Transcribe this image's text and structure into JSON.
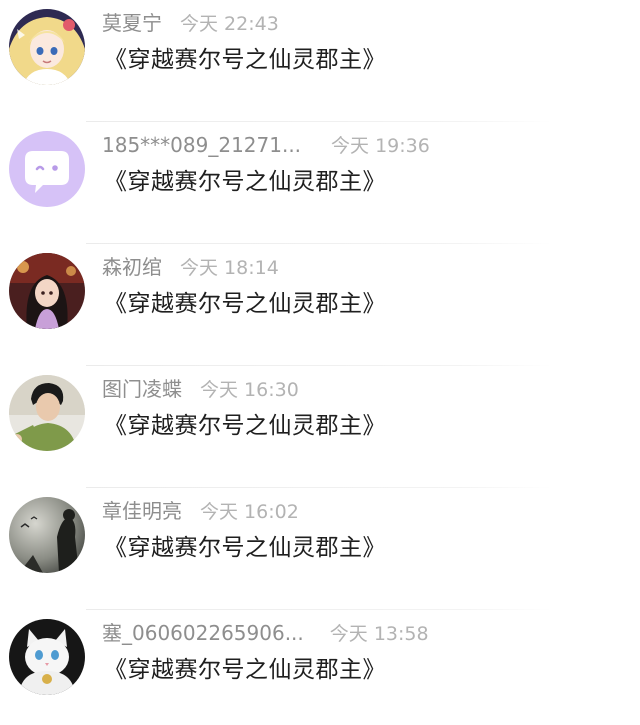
{
  "messages": [
    {
      "name": "莫夏宁",
      "time": "今天 22:43",
      "text": "《穿越赛尔号之仙灵郡主》",
      "avatar": "anime-girl-blonde-avatar"
    },
    {
      "name": "185***089_21271...",
      "time": "今天 19:36",
      "text": "《穿越赛尔号之仙灵郡主》",
      "avatar": "default-chat-bubble-avatar"
    },
    {
      "name": "森初绾",
      "time": "今天 18:14",
      "text": "《穿越赛尔号之仙灵郡主》",
      "avatar": "illustrated-girl-avatar"
    },
    {
      "name": "图门凌蝶",
      "time": "今天 16:30",
      "text": "《穿越赛尔号之仙灵郡主》",
      "avatar": "young-man-photo-avatar"
    },
    {
      "name": "章佳明亮",
      "time": "今天 16:02",
      "text": "《穿越赛尔号之仙灵郡主》",
      "avatar": "misty-silhouette-avatar"
    },
    {
      "name": "塞_060602265906...",
      "time": "今天 13:58",
      "text": "《穿越赛尔号之仙灵郡主》",
      "avatar": "white-cat-avatar"
    }
  ],
  "colors": {
    "default_avatar_bg": "#d6c2f7",
    "name_text": "#8e8e8e",
    "time_text": "#b3b3b3",
    "message_text": "#1f1f1f"
  }
}
